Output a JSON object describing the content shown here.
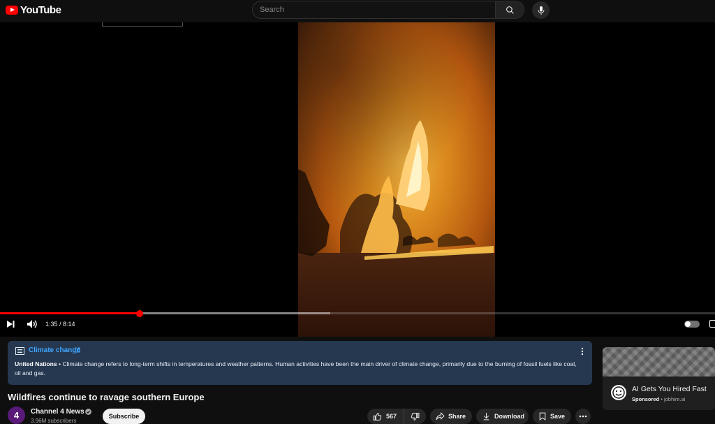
{
  "header": {
    "logo_text": "YouTube",
    "search_placeholder": "Search"
  },
  "player": {
    "current_time": "1:35",
    "separator": " / ",
    "duration": "8:14",
    "played_fraction": 0.195,
    "buffered_fraction": 0.462
  },
  "info_panel": {
    "title": "Climate change",
    "source": "United Nations",
    "separator": " • ",
    "text": "Climate change refers to long-term shifts in temperatures and weather patterns. Human activities have been the main driver of climate change, primarily due to the burning of fossil fuels like coal, oil and gas."
  },
  "video": {
    "title": "Wildfires continue to ravage southern Europe"
  },
  "channel": {
    "avatar_letter": "4",
    "name": "Channel 4 News",
    "subscribers": "3.96M subscribers",
    "subscribe_label": "Subscribe"
  },
  "actions": {
    "like_count": "567",
    "share_label": "Share",
    "download_label": "Download",
    "save_label": "Save"
  },
  "ad": {
    "title": "AI Gets You Hired Fast",
    "sponsored_label": "Sponsored",
    "separator": " • ",
    "domain": "jobhire.ai"
  },
  "colors": {
    "accent_red": "#ff0000",
    "link_blue": "#3ea6ff",
    "info_panel_bg": "#263850"
  }
}
